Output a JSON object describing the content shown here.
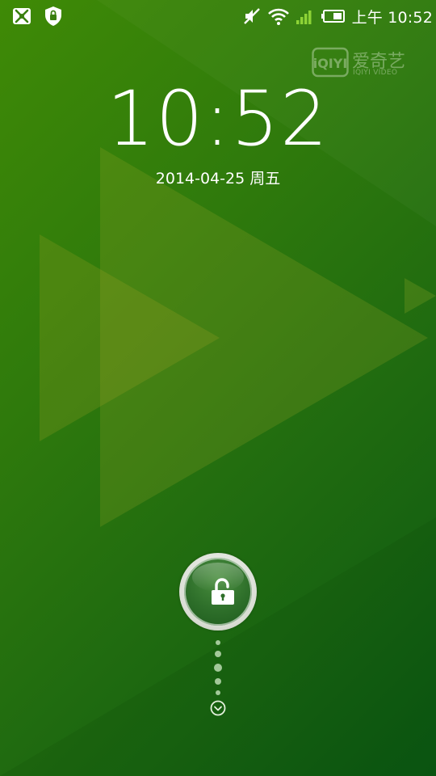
{
  "statusbar": {
    "left_icons": [
      "app-cat-icon",
      "shield-lock-icon"
    ],
    "right_icons": [
      "mute-icon",
      "wifi-icon",
      "signal-icon",
      "battery-icon"
    ],
    "time": "上午 10:52",
    "signal_color": "#8dd336"
  },
  "brand": {
    "logo_text": "iQIYI",
    "name": "爱奇艺",
    "sub": "IQIYI VIDEO"
  },
  "lockscreen": {
    "clock": "10:52",
    "date": "2014-04-25 周五"
  },
  "unlock": {
    "icon": "unlock-padlock-icon",
    "hint_icon": "chevron-down-circle-icon"
  },
  "colors": {
    "bg_top": "#3f8a06",
    "bg_bottom": "#0b5813",
    "text": "#ffffff"
  }
}
